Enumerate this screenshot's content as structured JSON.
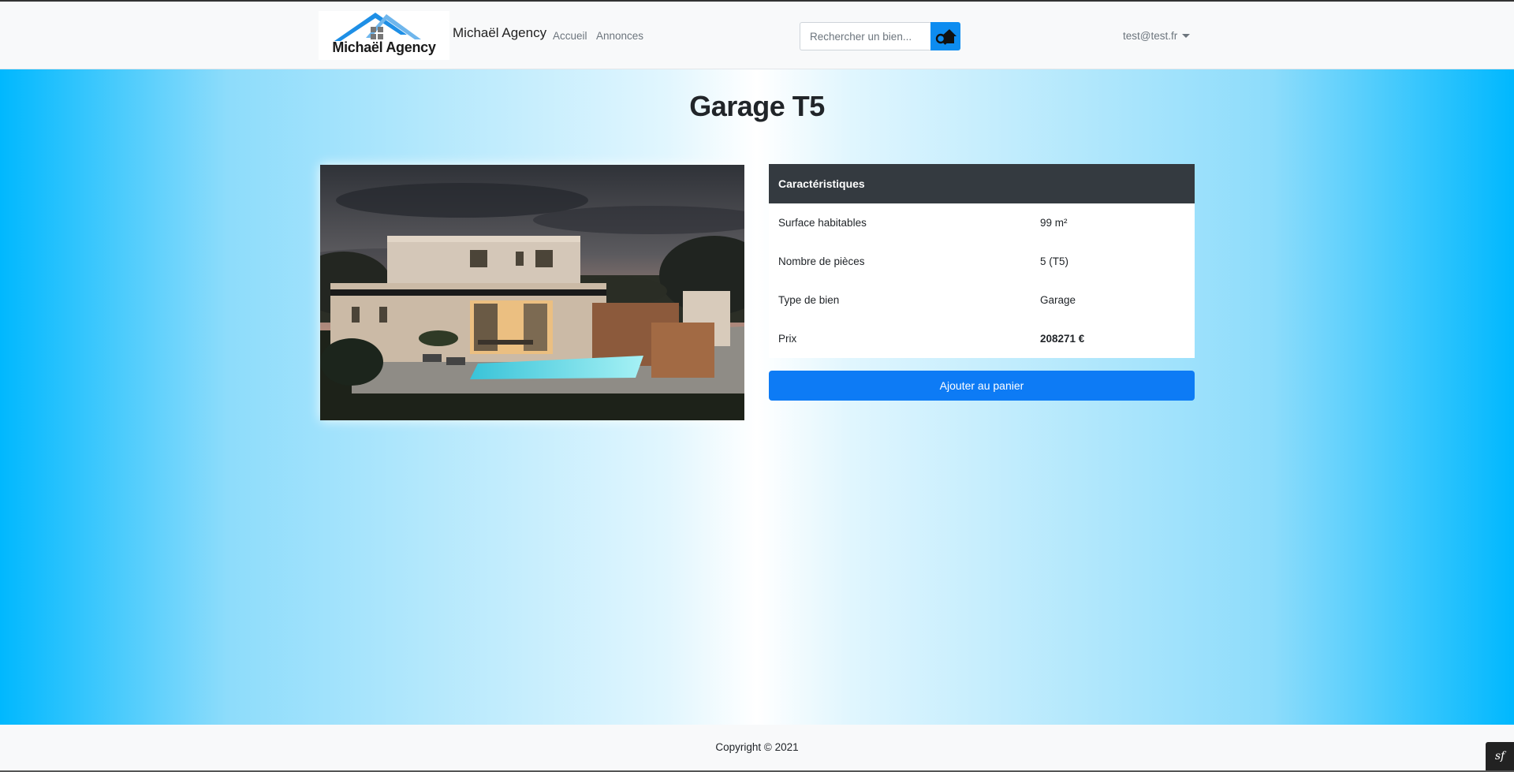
{
  "header": {
    "logo_text": "Michaël Agency",
    "brand": "Michaël Agency",
    "nav": [
      {
        "label": "Accueil"
      },
      {
        "label": "Annonces"
      }
    ],
    "search": {
      "placeholder": "Rechercher un bien..."
    },
    "user": {
      "email": "test@test.fr"
    }
  },
  "property": {
    "title": "Garage T5",
    "card_title": "Caractéristiques",
    "rows": [
      {
        "label": "Surface habitables",
        "value": "99 m²"
      },
      {
        "label": "Nombre de pièces",
        "value": "5 (T5)"
      },
      {
        "label": "Type de bien",
        "value": "Garage"
      },
      {
        "label": "Prix",
        "value": "208271 €"
      }
    ],
    "cart_button": "Ajouter au panier"
  },
  "footer": {
    "copyright": "Copyright © 2021",
    "debug_badge": "sf"
  },
  "colors": {
    "primary": "#0d7bf5",
    "dark": "#343a40",
    "gradient_edge": "#00b8fe"
  }
}
